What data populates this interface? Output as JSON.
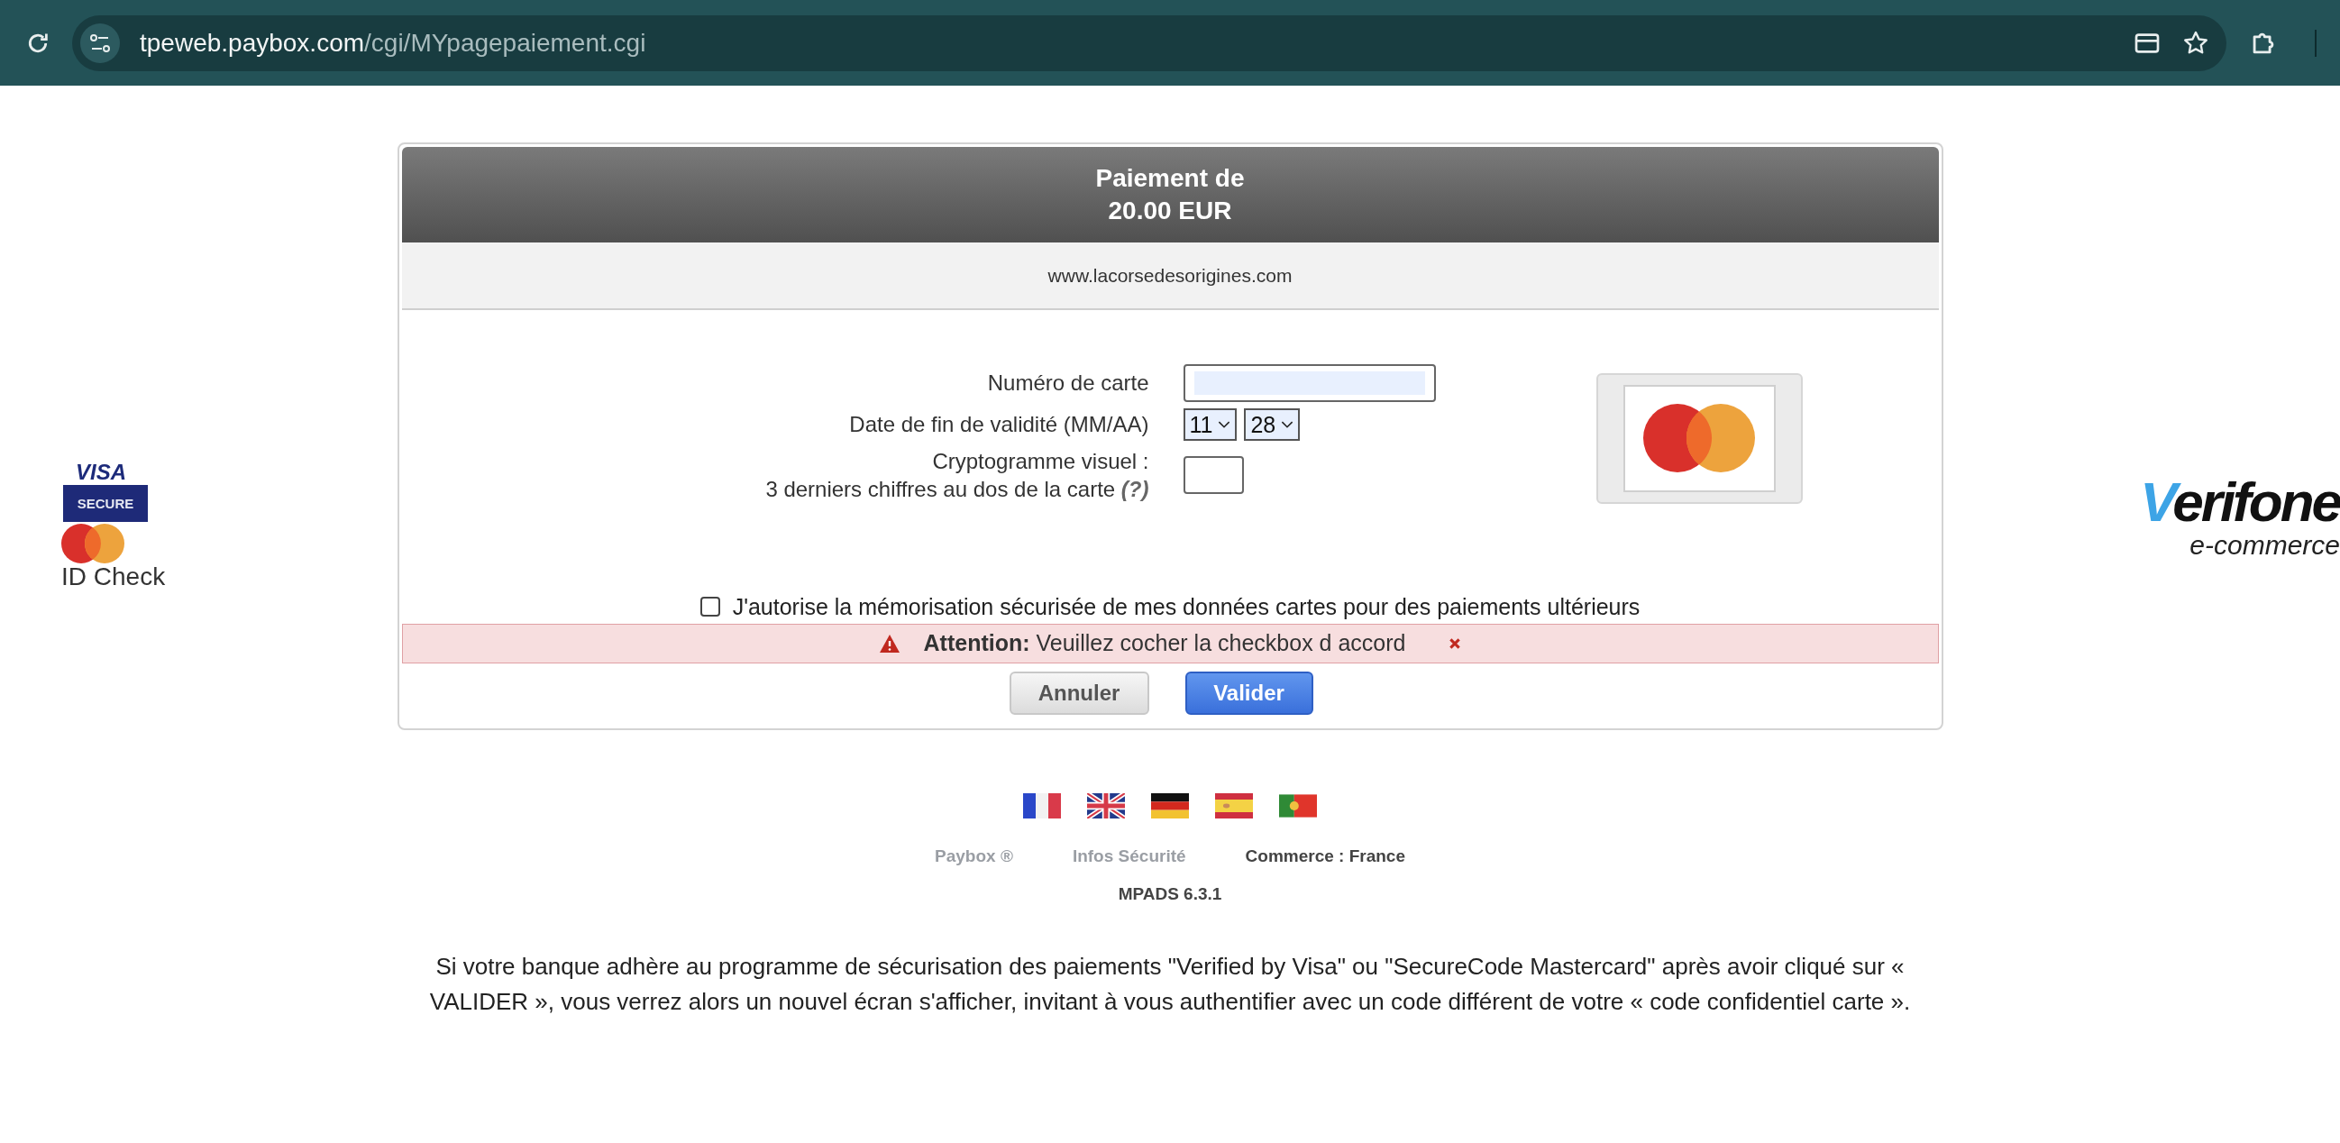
{
  "browser": {
    "url_host": "tpeweb.paybox.com",
    "url_path": "/cgi/MYpagepaiement.cgi"
  },
  "left_logos": {
    "visa_word": "VISA",
    "visa_badge": "SECURE",
    "mastercard_caption": "ID Check"
  },
  "right_logo": {
    "wordmark": "Verifone",
    "tagline": "e-commerce"
  },
  "card": {
    "title_lines": [
      "Paiement de",
      "20.00 EUR"
    ],
    "merchant": "www.lacorsedesorigines.com",
    "card_number": {
      "label": "Numéro de carte"
    },
    "expiry": {
      "label": "Date de fin de validité (MM/AA)",
      "month": "11",
      "year": "28"
    },
    "cvv": {
      "label_lines": [
        "Cryptogramme visuel :",
        "3 derniers chiffres au dos de la carte"
      ],
      "help": "(?)"
    },
    "consent": {
      "label": "J'autorise la mémorisation sécurisée de mes données cartes pour des paiements ultérieurs",
      "checked": false
    },
    "alert": {
      "title": "Attention:",
      "message": "Veuillez cocher la checkbox d accord"
    },
    "buttons": [
      {
        "label": "Annuler",
        "kind": "secondary"
      },
      {
        "label": "Valider",
        "kind": "primary"
      }
    ]
  },
  "footer": {
    "links": [
      {
        "label": "Paybox ®",
        "kind": "link"
      },
      {
        "label": "Infos Sécurité",
        "kind": "link"
      },
      {
        "label": "Commerce : France",
        "kind": "info"
      }
    ],
    "version": "MPADS 6.3.1"
  },
  "notice": "Si votre banque adhère au programme de sécurisation des paiements \"Verified by Visa\" ou \"SecureCode Mastercard\" après avoir cliqué sur « VALIDER », vous verrez alors un nouvel écran s'afficher, invitant à vous authentifier avec un code différent de votre « code confidentiel carte »."
}
